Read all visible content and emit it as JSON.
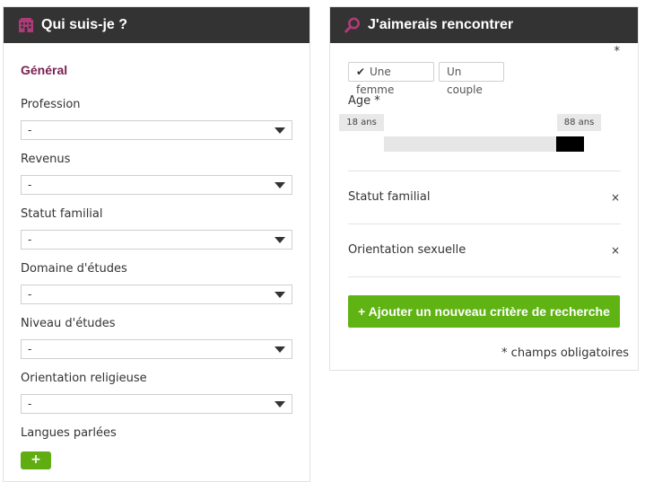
{
  "left_panel": {
    "title": "Qui suis-je ?",
    "icon": "building-icon",
    "section_title": "Général",
    "fields": [
      {
        "label": "Profession",
        "value": "-"
      },
      {
        "label": "Revenus",
        "value": "-"
      },
      {
        "label": "Statut familial",
        "value": "-"
      },
      {
        "label": "Domaine d'études",
        "value": "-"
      },
      {
        "label": "Niveau d'études",
        "value": "-"
      },
      {
        "label": "Orientation religieuse",
        "value": "-"
      }
    ],
    "languages": {
      "label": "Langues parlées",
      "add_label": "+"
    }
  },
  "right_panel": {
    "title": "J'aimerais rencontrer",
    "icon": "search-icon",
    "required_mark": "*",
    "gender_options": [
      {
        "label": "Une femme",
        "checked": true
      },
      {
        "label": "Un couple",
        "checked": false
      }
    ],
    "age": {
      "label": "Age *",
      "min_label": "18 ans",
      "max_label": "88 ans",
      "min": 18,
      "max": 88
    },
    "criteria": [
      {
        "label": "Statut familial",
        "remove": "×"
      },
      {
        "label": "Orientation sexuelle",
        "remove": "×"
      }
    ],
    "add_button": "+ Ajouter un nouveau critère de recherche",
    "footnote": "* champs obligatoires"
  },
  "colors": {
    "header_bg": "#333333",
    "accent": "#7a1f4f",
    "button_green": "#5fb312"
  }
}
